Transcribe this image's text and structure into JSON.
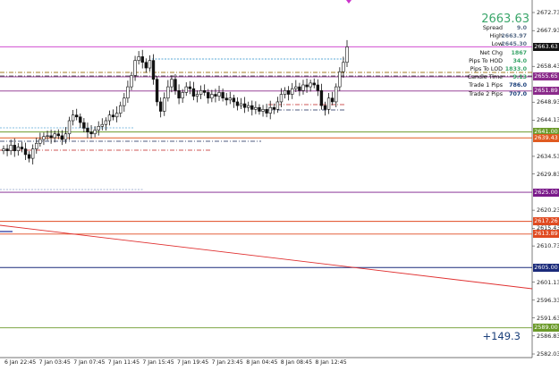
{
  "info_panel": {
    "current_price": "2663.63",
    "rows": [
      {
        "label": "Spread",
        "value": "9.0",
        "color": "#5b6f8a"
      },
      {
        "label": "High",
        "value": "2663.97",
        "color": "#5b6f8a"
      },
      {
        "label": "Low",
        "value": "2645.30",
        "color": "#5b6f8a"
      },
      {
        "label": "Net Chg",
        "value": "1867",
        "color": "#3aa66a"
      },
      {
        "label": "Pips To HOD",
        "value": "34.0",
        "color": "#3aa66a"
      },
      {
        "label": "Pips To LOD",
        "value": "1833.0",
        "color": "#3aa66a"
      },
      {
        "label": "Candle Time",
        "value": "9:13",
        "color": "#3aa66a"
      },
      {
        "label": "Trade 1 Pips",
        "value": "786.0",
        "color": "#1a3f7a"
      },
      {
        "label": "Trade 2 Pips",
        "value": "707.0",
        "color": "#1a3f7a"
      }
    ],
    "total_pl": "+149.3"
  },
  "chart_data": {
    "type": "candlestick",
    "ylim": [
      2582.03,
      2674.5
    ],
    "y_ticks": [
      {
        "value": 2672.73,
        "label": "2672.73"
      },
      {
        "value": 2667.93,
        "label": "2667.93"
      },
      {
        "value": 2658.43,
        "label": "2658.43"
      },
      {
        "value": 2648.93,
        "label": "2648.93"
      },
      {
        "value": 2644.13,
        "label": "2644.13"
      },
      {
        "value": 2634.53,
        "label": "2634.53"
      },
      {
        "value": 2629.83,
        "label": "2629.83"
      },
      {
        "value": 2620.23,
        "label": "2620.23"
      },
      {
        "value": 2615.43,
        "label": "2615.43"
      },
      {
        "value": 2610.73,
        "label": "2610.73"
      },
      {
        "value": 2601.13,
        "label": "2601.13"
      },
      {
        "value": 2596.33,
        "label": "2596.33"
      },
      {
        "value": 2591.63,
        "label": "2591.63"
      },
      {
        "value": 2586.83,
        "label": "2586.83"
      },
      {
        "value": 2582.03,
        "label": "2582.03"
      }
    ],
    "x_ticks": [
      "6 Jan 22:45",
      "7 Jan 03:45",
      "7 Jan 07:45",
      "7 Jan 11:45",
      "7 Jan 15:45",
      "7 Jan 19:45",
      "7 Jan 23:45",
      "8 Jan 04:45",
      "8 Jan 08:45",
      "8 Jan 12:45"
    ],
    "price_levels": [
      {
        "value": 2663.63,
        "label": "2663.63",
        "color": "#cc33cc",
        "badge": "#111111"
      },
      {
        "value": 2655.65,
        "label": "2655.65",
        "color": "#8a2a8a",
        "badge": "#8a2a8a"
      },
      {
        "value": 2651.89,
        "label": "2651.89",
        "color": "#8a2a8a",
        "badge": "#8a2a8a"
      },
      {
        "value": 2641.0,
        "label": "2641.00",
        "color": "#6b9a2a",
        "badge": "#6b9a2a"
      },
      {
        "value": 2639.43,
        "label": "2639.43",
        "color": "#e05a20",
        "badge": "#e05a20"
      },
      {
        "value": 2625.0,
        "label": "2625.00",
        "color": "#7a1a8a",
        "badge": "#7a1a8a"
      },
      {
        "value": 2617.26,
        "label": "2617.26",
        "color": "#e04a20",
        "badge": "#e04a20"
      },
      {
        "value": 2613.89,
        "label": "2613.89",
        "color": "#e04a20",
        "badge": "#e04a20"
      },
      {
        "value": 2605.0,
        "label": "2605.00",
        "color": "#1a2a7a",
        "badge": "#1a2a7a"
      },
      {
        "value": 2589.0,
        "label": "2589.00",
        "color": "#6b9a2a",
        "badge": "#6b9a2a"
      }
    ],
    "closes": [
      2636.5,
      2636.0,
      2637.5,
      2636.0,
      2637.0,
      2636.5,
      2635.0,
      2634.0,
      2636.5,
      2638.0,
      2639.0,
      2639.8,
      2640.0,
      2639.5,
      2640.5,
      2640.0,
      2639.0,
      2640.5,
      2644.0,
      2645.5,
      2645.0,
      2643.5,
      2642.0,
      2641.0,
      2640.5,
      2641.5,
      2642.5,
      2643.0,
      2644.0,
      2645.5,
      2645.0,
      2646.0,
      2648.0,
      2650.0,
      2653.0,
      2656.0,
      2660.0,
      2661.0,
      2659.5,
      2658.0,
      2660.0,
      2655.0,
      2649.0,
      2646.5,
      2650.0,
      2653.0,
      2655.0,
      2652.0,
      2650.0,
      2651.5,
      2653.0,
      2652.5,
      2650.5,
      2651.0,
      2652.0,
      2651.5,
      2650.0,
      2651.0,
      2650.5,
      2651.5,
      2650.0,
      2649.5,
      2650.0,
      2649.0,
      2648.0,
      2648.5,
      2647.5,
      2648.0,
      2647.0,
      2647.5,
      2646.5,
      2647.0,
      2646.0,
      2647.5,
      2647.0,
      2649.0,
      2651.0,
      2652.0,
      2651.0,
      2652.5,
      2653.0,
      2652.0,
      2653.5,
      2653.0,
      2654.0,
      2653.5,
      2652.0,
      2648.0,
      2647.0,
      2650.0,
      2649.0,
      2653.0,
      2657.0,
      2659.5,
      2663.6
    ]
  }
}
